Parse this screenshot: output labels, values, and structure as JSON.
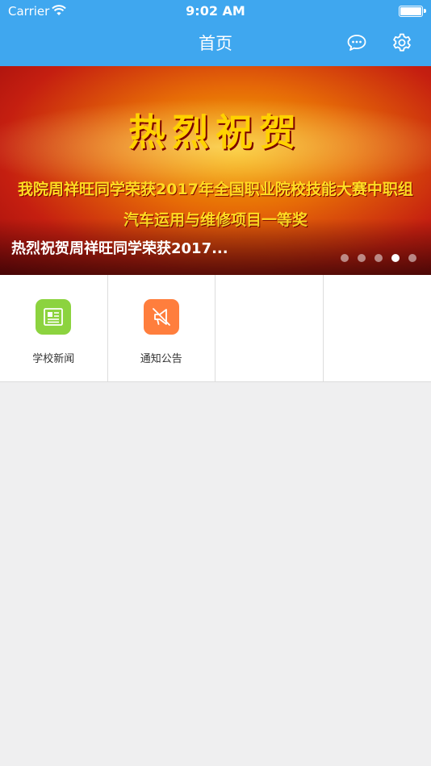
{
  "status_bar": {
    "carrier": "Carrier",
    "time": "9:02 AM"
  },
  "nav": {
    "title": "首页",
    "chat_icon": "chat-bubble-icon",
    "settings_icon": "gear-icon"
  },
  "banner": {
    "headline": "热烈祝贺",
    "line1": "我院周祥旺同学荣获2017年全国职业院校技能大赛中职组",
    "line2": "汽车运用与维修项目一等奖",
    "caption": "热烈祝贺周祥旺同学荣获2017...",
    "slide_count": 5,
    "active_slide": 4
  },
  "menu": {
    "items": [
      {
        "label": "学校新闻",
        "icon": "newspaper-icon",
        "color": "#8cd33f"
      },
      {
        "label": "通知公告",
        "icon": "megaphone-icon",
        "color": "#ff7e3d"
      }
    ]
  },
  "colors": {
    "nav_background": "#3fa7ef",
    "page_background": "#efeff0"
  }
}
